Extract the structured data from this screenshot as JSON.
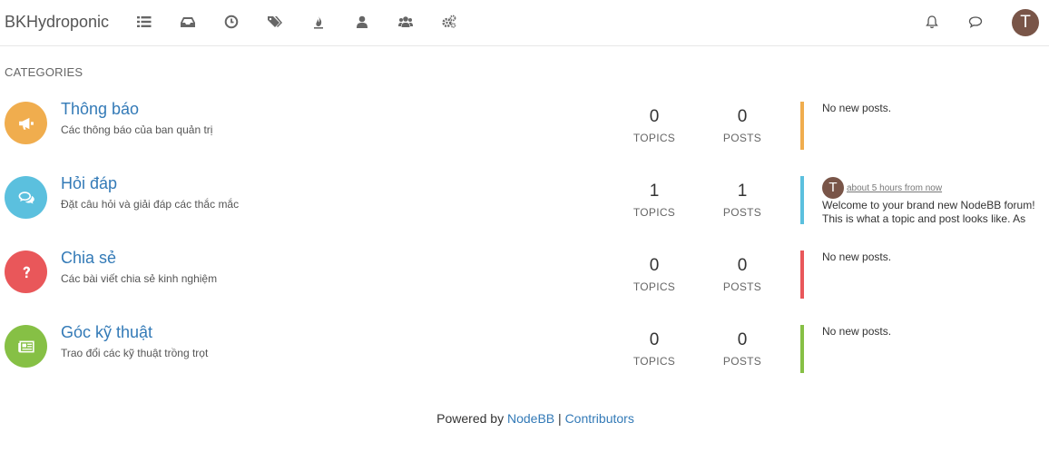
{
  "header": {
    "brand": "BKHydroponic",
    "nav_icons": [
      "categories-icon",
      "unread-icon",
      "recent-icon",
      "tags-icon",
      "popular-icon",
      "users-icon",
      "groups-icon",
      "admin-icon"
    ],
    "avatar_initial": "T"
  },
  "section_title": "CATEGORIES",
  "categories": [
    {
      "title": "Thông báo",
      "description": "Các thông báo của ban quản trị",
      "topics": "0",
      "posts": "0",
      "color": "#f0ad4e",
      "icon": "megaphone-icon",
      "teaser": "No new posts."
    },
    {
      "title": "Hỏi đáp",
      "description": "Đặt câu hỏi và giải đáp các thắc mắc",
      "topics": "1",
      "posts": "1",
      "color": "#5bc0de",
      "icon": "chat-icon",
      "teaser_avatar": "T",
      "teaser_time": "about 5 hours from now",
      "teaser_body": "Welcome to your brand new NodeBB forum! This is what a topic and post looks like. As"
    },
    {
      "title": "Chia sẻ",
      "description": "Các bài viết chia sẻ kinh nghiệm",
      "topics": "0",
      "posts": "0",
      "color": "#e9575a",
      "icon": "question-icon",
      "teaser": "No new posts."
    },
    {
      "title": "Góc kỹ thuật",
      "description": "Trao đổi các kỹ thuật trồng trọt",
      "topics": "0",
      "posts": "0",
      "color": "#86c045",
      "icon": "newspaper-icon",
      "teaser": "No new posts."
    }
  ],
  "labels": {
    "topics": "TOPICS",
    "posts": "POSTS"
  },
  "footer": {
    "prefix": "Powered by ",
    "nodebb": "NodeBB",
    "separator": " | ",
    "contributors": "Contributors"
  }
}
